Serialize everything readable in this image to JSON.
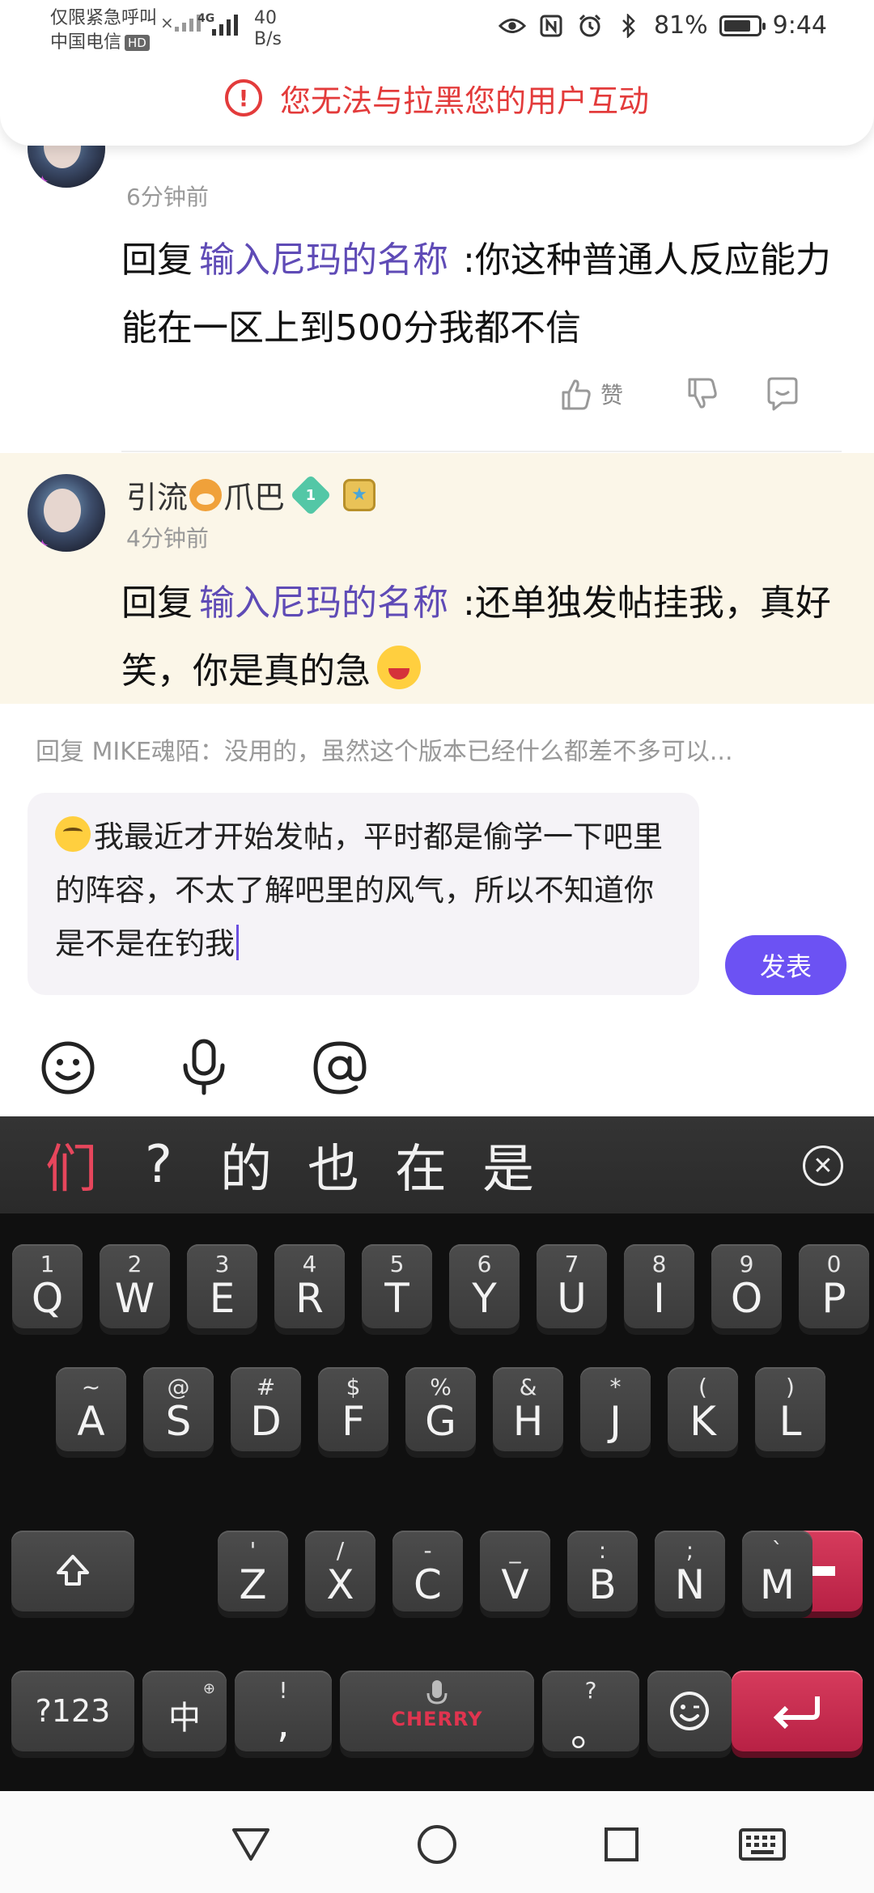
{
  "status_bar": {
    "emergency_text": "仅限紧急呼叫",
    "carrier": "中国电信",
    "hd_badge": "HD",
    "network_type": "4G",
    "speed_value": "40",
    "speed_unit": "B/s",
    "battery_percent": "81%",
    "battery_level": 0.81,
    "time": "9:44"
  },
  "toast": {
    "icon": "exclamation-icon",
    "message": "您无法与拉黑您的用户互动"
  },
  "comments": [
    {
      "time": "6分钟前",
      "reply_prefix": "回复",
      "mention": "输入尼玛的名称",
      "text": ":你这种普通人反应能力能在一区上到500分我都不信",
      "like_label": "赞"
    },
    {
      "author": "引流🐶爪巴",
      "author_name_part1": "引流",
      "author_name_part2": "爪巴",
      "level": "1",
      "time": "4分钟前",
      "reply_prefix": "回复",
      "mention": "输入尼玛的名称",
      "text": ":还单独发帖挂我，真好笑，你是真的急"
    }
  ],
  "composer": {
    "reply_hint": "回复 MIKE魂陌：没用的，虽然这个版本已经什么都差不多可以...",
    "input_value": "我最近才开始发帖，平时都是偷学一下吧里的阵容，不太了解吧里的风气，所以不知道你是不是在钓我",
    "send_label": "发表",
    "accent_color": "#6c52f3"
  },
  "keyboard": {
    "candidates": [
      "们",
      "?",
      "的",
      "也",
      "在",
      "是"
    ],
    "row1": [
      {
        "main": "Q",
        "alt": "1"
      },
      {
        "main": "W",
        "alt": "2"
      },
      {
        "main": "E",
        "alt": "3"
      },
      {
        "main": "R",
        "alt": "4"
      },
      {
        "main": "T",
        "alt": "5"
      },
      {
        "main": "Y",
        "alt": "6"
      },
      {
        "main": "U",
        "alt": "7"
      },
      {
        "main": "I",
        "alt": "8"
      },
      {
        "main": "O",
        "alt": "9"
      },
      {
        "main": "P",
        "alt": "0"
      }
    ],
    "row2": [
      {
        "main": "A",
        "alt": "~"
      },
      {
        "main": "S",
        "alt": "@"
      },
      {
        "main": "D",
        "alt": "#"
      },
      {
        "main": "F",
        "alt": "$"
      },
      {
        "main": "G",
        "alt": "%"
      },
      {
        "main": "H",
        "alt": "&"
      },
      {
        "main": "J",
        "alt": "*"
      },
      {
        "main": "K",
        "alt": "("
      },
      {
        "main": "L",
        "alt": ")"
      }
    ],
    "row3": [
      {
        "main": "Z",
        "alt": "'"
      },
      {
        "main": "X",
        "alt": "/"
      },
      {
        "main": "C",
        "alt": "-"
      },
      {
        "main": "V",
        "alt": "_"
      },
      {
        "main": "B",
        "alt": ":"
      },
      {
        "main": "N",
        "alt": ";"
      },
      {
        "main": "M",
        "alt": "`"
      }
    ],
    "symbols_key": "?123",
    "lang_key": "中",
    "punct_key_main": ",",
    "punct_key_alt": "!",
    "period_key_main": "。",
    "period_key_alt": "?",
    "space_brand": "CHERRY",
    "key_accent_color": "#c72a4e"
  }
}
